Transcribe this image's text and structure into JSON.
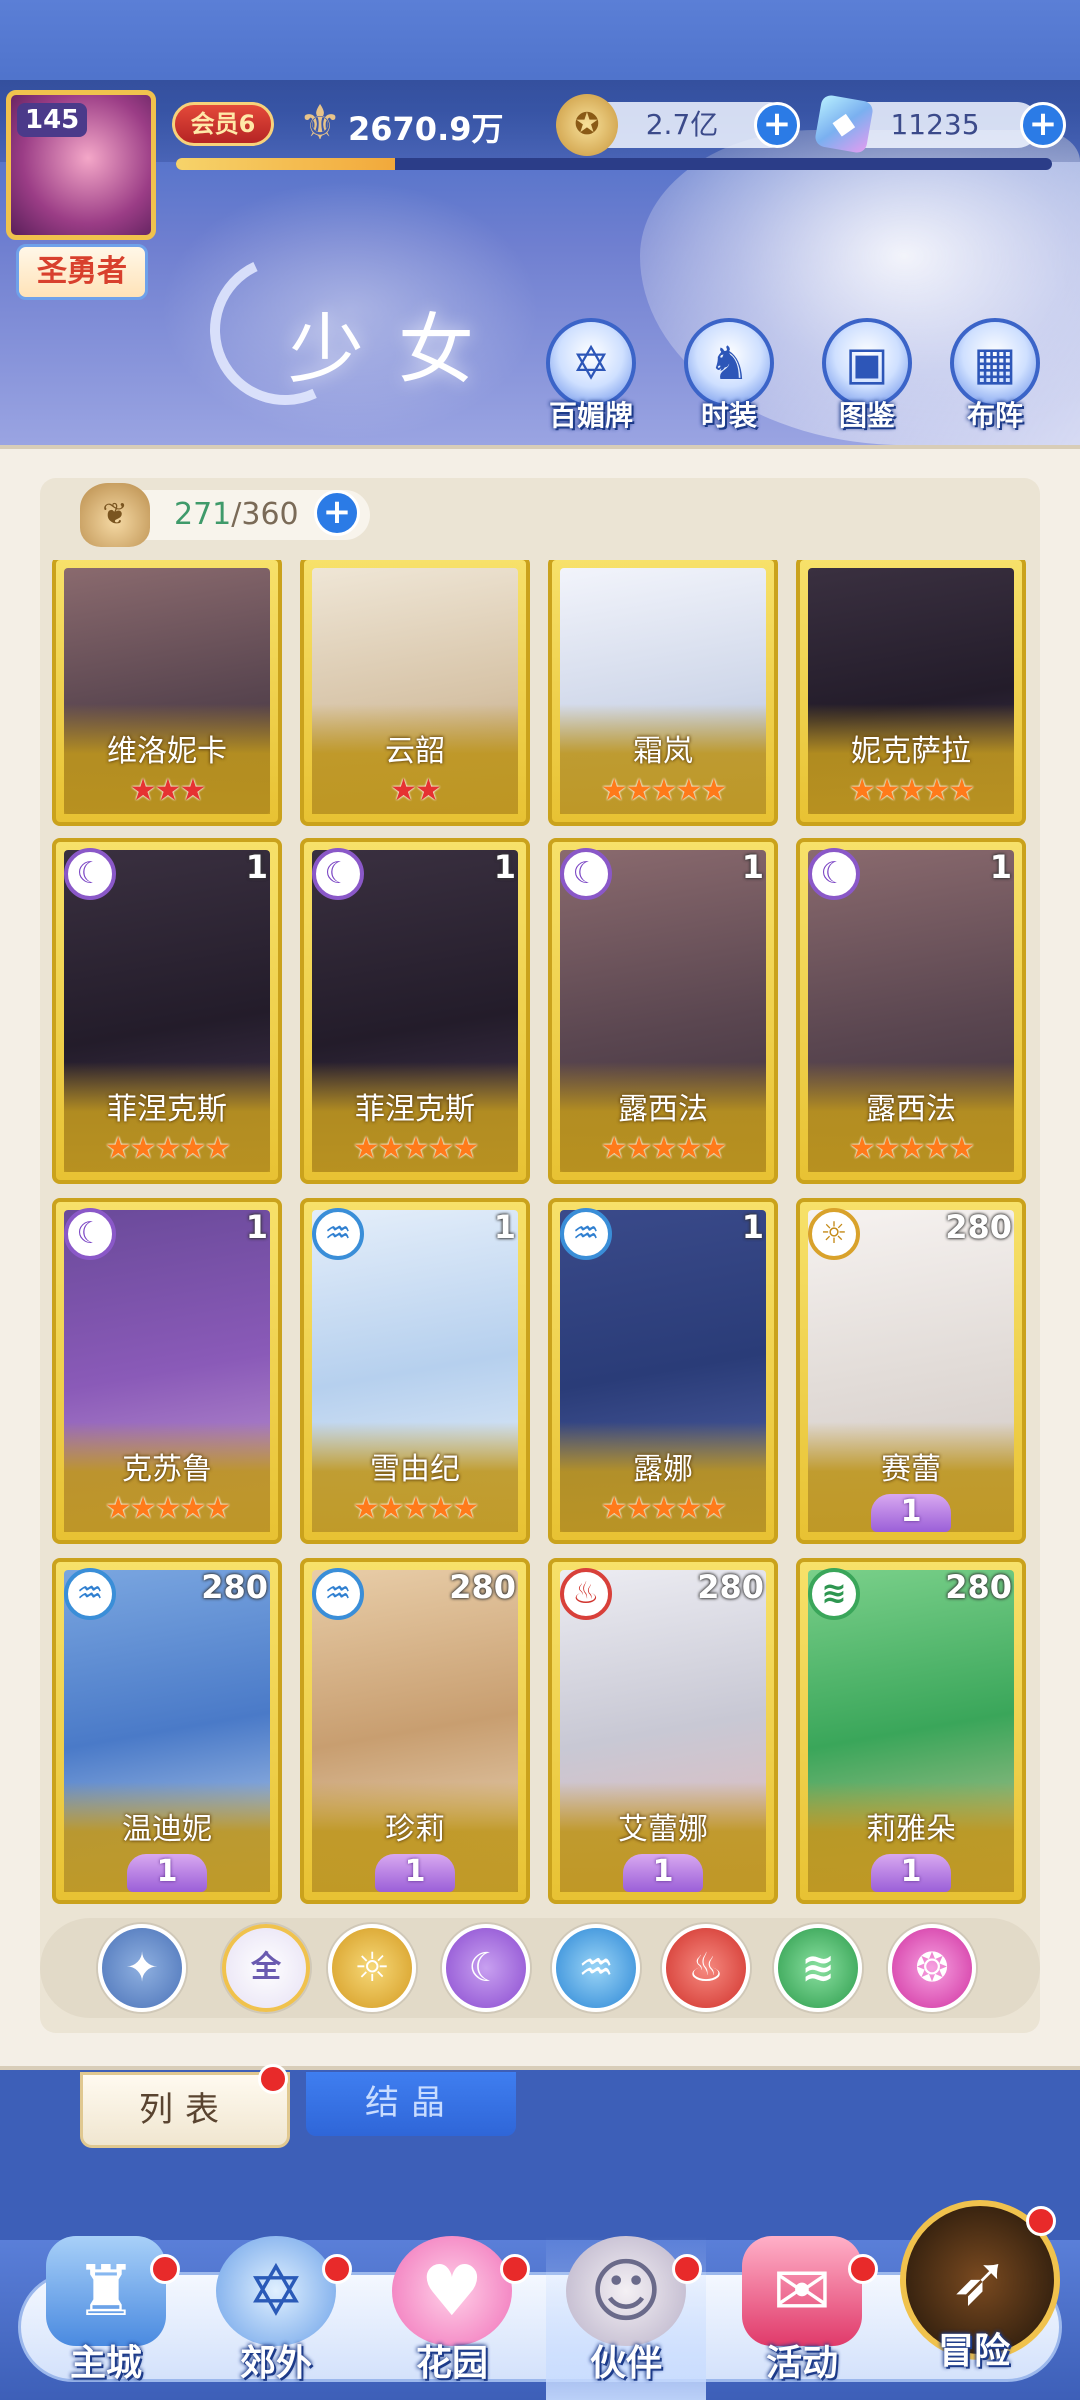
{
  "header": {
    "level": "145",
    "title_badge": "圣勇者",
    "vip": "会员6",
    "power": "2670.9万",
    "exp_progress": 0.25,
    "gold": "2.7亿",
    "gems": "11235",
    "page_title": "少女",
    "functions": [
      {
        "label": "百媚牌",
        "icon": "card-deck-icon"
      },
      {
        "label": "时装",
        "icon": "costume-icon"
      },
      {
        "label": "图鉴",
        "icon": "codex-book-icon"
      },
      {
        "label": "布阵",
        "icon": "formation-grid-icon"
      }
    ]
  },
  "capacity": {
    "used": "271",
    "total": "/360"
  },
  "cards": [
    {
      "name": "维洛妮卡",
      "stars": "★★★",
      "star_color": "red",
      "art": "a-brown"
    },
    {
      "name": "云韶",
      "stars": "★★",
      "star_color": "red",
      "art": "a-cream"
    },
    {
      "name": "霜岚",
      "stars": "★★★★★",
      "star_color": "orange",
      "art": "a-white"
    },
    {
      "name": "妮克萨拉",
      "stars": "★★★★★",
      "star_color": "orange",
      "art": "a-dark"
    },
    {
      "name": "菲涅克斯",
      "stars": "★★★★★",
      "star_color": "orange",
      "element": "dark",
      "count": "1",
      "art": "a-dark"
    },
    {
      "name": "菲涅克斯",
      "stars": "★★★★★",
      "star_color": "orange",
      "element": "dark",
      "count": "1",
      "art": "a-dark"
    },
    {
      "name": "露西法",
      "stars": "★★★★★",
      "star_color": "orange",
      "element": "dark",
      "count": "1",
      "art": "a-brown"
    },
    {
      "name": "露西法",
      "stars": "★★★★★",
      "star_color": "orange",
      "element": "dark",
      "count": "1",
      "art": "a-brown"
    },
    {
      "name": "克苏鲁",
      "stars": "★★★★★",
      "star_color": "orange",
      "element": "dark",
      "count": "1",
      "art": "a-violet"
    },
    {
      "name": "雪由纪",
      "stars": "★★★★★",
      "star_color": "orange",
      "element": "water",
      "count": "1",
      "art": "a-ice"
    },
    {
      "name": "露娜",
      "stars": "★★★★★",
      "star_color": "orange",
      "element": "water",
      "count": "1",
      "art": "a-navy"
    },
    {
      "name": "赛蕾",
      "rank": "1",
      "element": "light",
      "count": "280",
      "art": "a-pearl"
    },
    {
      "name": "温迪妮",
      "rank": "1",
      "element": "water",
      "count": "280",
      "art": "a-blue"
    },
    {
      "name": "珍莉",
      "rank": "1",
      "element": "water",
      "count": "280",
      "art": "a-tan"
    },
    {
      "name": "艾蕾娜",
      "rank": "1",
      "element": "fire",
      "count": "280",
      "art": "a-silver"
    },
    {
      "name": "莉雅朵",
      "rank": "1",
      "element": "wind",
      "count": "280",
      "art": "a-green"
    }
  ],
  "filters": [
    {
      "name": "filter-rarity",
      "label": "✦",
      "cls": "f-first"
    },
    {
      "name": "filter-all",
      "label": "全",
      "cls": "f-all"
    },
    {
      "name": "filter-light",
      "label": "☼",
      "cls": "f-light"
    },
    {
      "name": "filter-dark",
      "label": "☾",
      "cls": "f-dark"
    },
    {
      "name": "filter-water",
      "label": "♒",
      "cls": "f-water"
    },
    {
      "name": "filter-fire",
      "label": "♨",
      "cls": "f-fire"
    },
    {
      "name": "filter-wind",
      "label": "≋",
      "cls": "f-wind"
    },
    {
      "name": "filter-charm",
      "label": "❂",
      "cls": "f-heart"
    }
  ],
  "tabs": {
    "list": "列表",
    "crystal": "结晶"
  },
  "nav": [
    {
      "label": "主城",
      "icon": "castle-icon",
      "cls": "n-castle"
    },
    {
      "label": "郊外",
      "icon": "outskirts-gate-icon",
      "cls": "n-outer"
    },
    {
      "label": "花园",
      "icon": "garden-heart-icon",
      "cls": "n-garden"
    },
    {
      "label": "伙伴",
      "icon": "partner-portrait-icon",
      "cls": "n-partner"
    },
    {
      "label": "活动",
      "icon": "gift-box-icon",
      "cls": "n-event"
    }
  ],
  "adventure": "冒险",
  "element_glyphs": {
    "dark": "☾",
    "water": "♒",
    "light": "☼",
    "fire": "♨",
    "wind": "≋"
  }
}
